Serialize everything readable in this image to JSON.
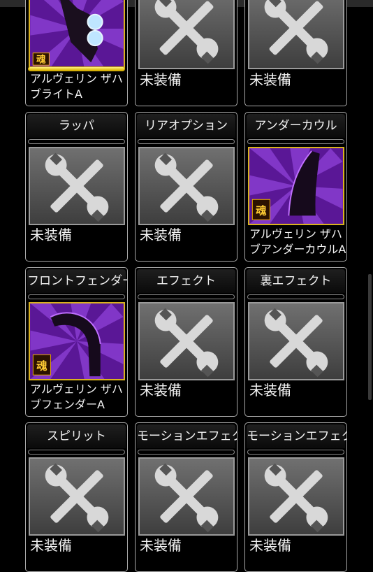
{
  "colors": {
    "background": "#000000",
    "frame": "#a8a8a8",
    "gold": "#d9b21e",
    "purple": "#6a1aa8"
  },
  "icons": {
    "empty_slot": "wrench-screwdriver-icon",
    "scrollbar": "scrollbar"
  },
  "badge_text": "魂",
  "slots": [
    {
      "name": "",
      "empty": false,
      "label_1": "アルヴェリン ザハ",
      "label_2": "ブライトA",
      "thumb_type": "headlight"
    },
    {
      "name": "",
      "empty": true,
      "label_1": "未装備"
    },
    {
      "name": "",
      "empty": true,
      "label_1": "未装備"
    },
    {
      "name": "ラッパ",
      "empty": true,
      "label_1": "未装備"
    },
    {
      "name": "リアオプション",
      "empty": true,
      "label_1": "未装備"
    },
    {
      "name": "アンダーカウル",
      "empty": false,
      "label_1": "アルヴェリン ザハ",
      "label_2": "ブアンダーカウルA",
      "thumb_type": "undercowl"
    },
    {
      "name": "フロントフェンダー",
      "empty": false,
      "label_1": "アルヴェリン ザハ",
      "label_2": "ブフェンダーA",
      "thumb_type": "fender"
    },
    {
      "name": "エフェクト",
      "empty": true,
      "label_1": "未装備"
    },
    {
      "name": "裏エフェクト",
      "empty": true,
      "label_1": "未装備"
    },
    {
      "name": "スピリット",
      "empty": true,
      "label_1": "未装備"
    },
    {
      "name": "モーションエフェクト",
      "empty": true,
      "label_1": "未装備"
    },
    {
      "name": "モーションエフェクトII",
      "empty": true,
      "label_1": "未装備"
    }
  ]
}
